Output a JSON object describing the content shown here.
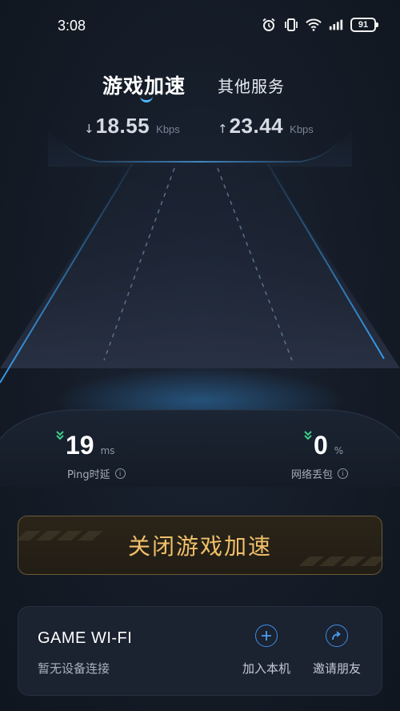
{
  "status_bar": {
    "time": "3:08",
    "battery": "91",
    "icons": [
      "alarm-icon",
      "vibrate-icon",
      "wifi-icon",
      "cellular-icon",
      "battery-icon"
    ]
  },
  "tabs": {
    "active": "游戏加速",
    "other": "其他服务"
  },
  "speed": {
    "download": {
      "value": "18.55",
      "unit": "Kbps",
      "arrow": "↓"
    },
    "upload": {
      "value": "23.44",
      "unit": "Kbps",
      "arrow": "↑"
    }
  },
  "stats": {
    "ping": {
      "value": "19",
      "unit": "ms",
      "label": "Ping时延"
    },
    "packet_loss": {
      "value": "0",
      "unit": "%",
      "label": "网络丢包"
    }
  },
  "main_button": {
    "label": "关闭游戏加速"
  },
  "wifi_card": {
    "title": "GAME WI-FI",
    "subtitle": "暂无设备连接",
    "join_label": "加入本机",
    "invite_label": "邀请朋友"
  },
  "colors": {
    "background": "#141b26",
    "accent_blue": "#4fb5ff",
    "button_gold": "#f1c06a",
    "good_green": "#3fcf8a"
  }
}
